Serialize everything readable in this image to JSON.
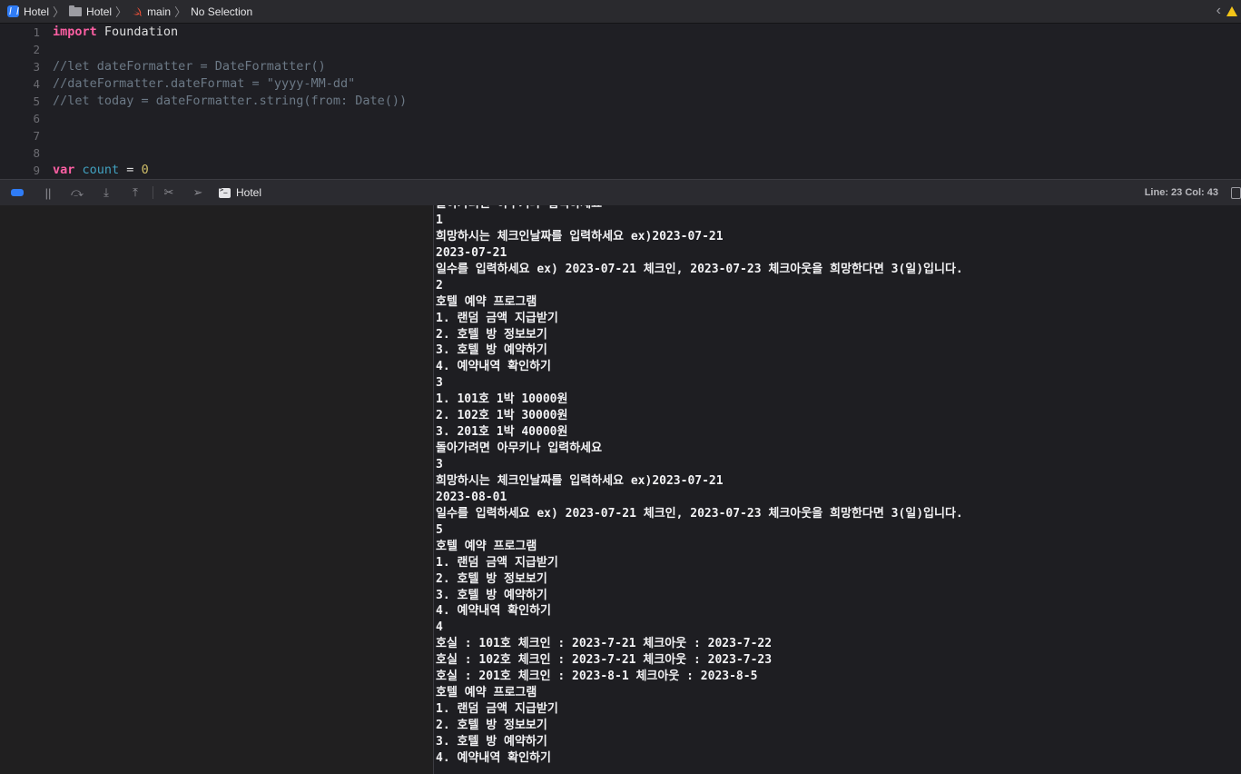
{
  "jumpbar": {
    "crumbs": [
      "Hotel",
      "Hotel",
      "main",
      "No Selection"
    ]
  },
  "editor": {
    "lines": [
      {
        "n": "1",
        "tokens": [
          {
            "t": "kw",
            "s": "import"
          },
          {
            "t": "id",
            "s": " Foundation"
          }
        ]
      },
      {
        "n": "2",
        "tokens": []
      },
      {
        "n": "3",
        "tokens": [
          {
            "t": "cm",
            "s": "//let dateFormatter = DateFormatter()"
          }
        ]
      },
      {
        "n": "4",
        "tokens": [
          {
            "t": "cm",
            "s": "//dateFormatter.dateFormat = \"yyyy-MM-dd\""
          }
        ]
      },
      {
        "n": "5",
        "tokens": [
          {
            "t": "cm",
            "s": "//let today = dateFormatter.string(from: Date())"
          }
        ]
      },
      {
        "n": "6",
        "tokens": []
      },
      {
        "n": "7",
        "tokens": []
      },
      {
        "n": "8",
        "tokens": []
      },
      {
        "n": "9",
        "tokens": [
          {
            "t": "kw",
            "s": "var"
          },
          {
            "t": "id",
            "s": " "
          },
          {
            "t": "var",
            "s": "count"
          },
          {
            "t": "id",
            "s": " = "
          },
          {
            "t": "num",
            "s": "0"
          }
        ]
      }
    ]
  },
  "debugbar": {
    "target": "Hotel",
    "line_col": "Line: 23  Col: 43"
  },
  "console": {
    "lines": [
      "돌아가려면 아무키나 입력하세요",
      "1",
      "희망하시는 체크인날짜를 입력하세요 ex)2023-07-21",
      "2023-07-21",
      "일수를 입력하세요 ex) 2023-07-21 체크인, 2023-07-23 체크아웃을 희망한다면 3(일)입니다.",
      "2",
      "호텔 예약 프로그램",
      "1. 랜덤 금액 지급받기",
      "2. 호텔 방 정보보기",
      "3. 호텔 방 예약하기",
      "4. 예약내역 확인하기",
      "3",
      "1. 101호 1박 10000원",
      "2. 102호 1박 30000원",
      "3. 201호 1박 40000원",
      "돌아가려면 아무키나 입력하세요",
      "3",
      "희망하시는 체크인날짜를 입력하세요 ex)2023-07-21",
      "2023-08-01",
      "일수를 입력하세요 ex) 2023-07-21 체크인, 2023-07-23 체크아웃을 희망한다면 3(일)입니다.",
      "5",
      "호텔 예약 프로그램",
      "1. 랜덤 금액 지급받기",
      "2. 호텔 방 정보보기",
      "3. 호텔 방 예약하기",
      "4. 예약내역 확인하기",
      "4",
      "호실 : 101호 체크인 : 2023-7-21 체크아웃 : 2023-7-22",
      "호실 : 102호 체크인 : 2023-7-21 체크아웃 : 2023-7-23",
      "호실 : 201호 체크인 : 2023-8-1 체크아웃 : 2023-8-5",
      "호텔 예약 프로그램",
      "1. 랜덤 금액 지급받기",
      "2. 호텔 방 정보보기",
      "3. 호텔 방 예약하기",
      "4. 예약내역 확인하기"
    ]
  }
}
